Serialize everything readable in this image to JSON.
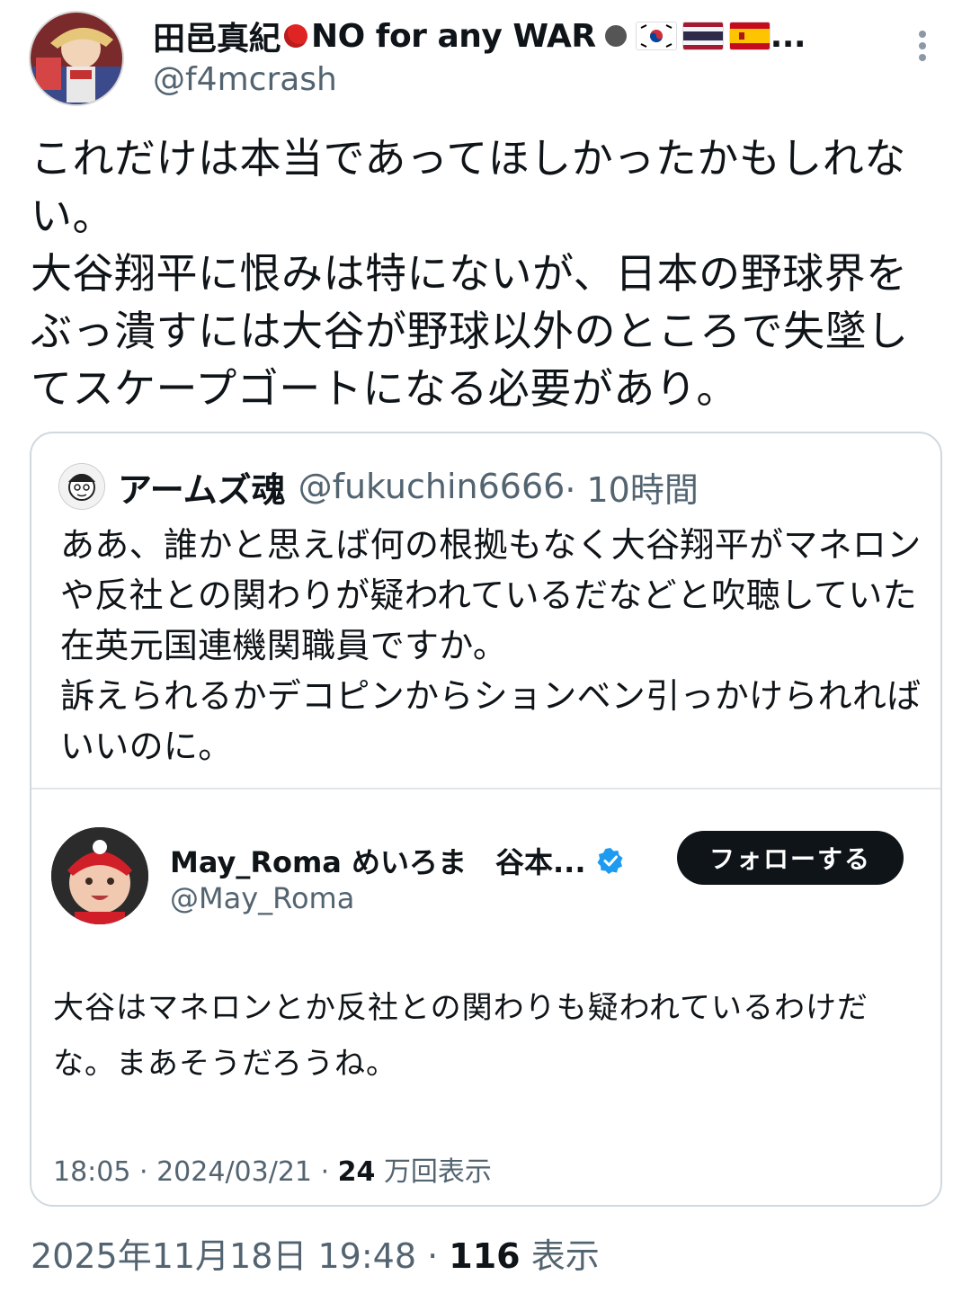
{
  "author": {
    "display_name": "田邑真紀",
    "status_text": "NO for any WAR",
    "ellipsis": "...",
    "handle": "@f4mcrash",
    "flags": [
      "korea-flag",
      "thailand-flag",
      "spain-flag"
    ]
  },
  "tweet": {
    "lines": [
      "これだけは本当であってほしかったかもしれない。",
      "大谷翔平に恨みは特にないが、日本の野球界をぶっ潰すには大谷が野球以外のところで失墜してスケープゴートになる必要があり。"
    ],
    "timestamp": "2025年11月18日 19:48",
    "separator": " · ",
    "views_count": "116",
    "views_label": " 表示"
  },
  "quoted": {
    "display_name": "アームズ魂",
    "handle": "@fukuchin6666",
    "time_ago": " · 10時間",
    "lines": [
      "ああ、誰かと思えば何の根拠もなく大谷翔平がマネロンや反社との関わりが疑われているだなどと吹聴していた在英元国連機関職員ですか。",
      "訴えられるかデコピンからションベン引っかけられればいいのに。"
    ],
    "embedded": {
      "display_name": "May_Roma めいろま　谷本...",
      "handle": "@May_Roma",
      "follow_label": "フォローする",
      "text": "大谷はマネロンとか反社との関わりも疑われているわけだな。まあそうだろうね。",
      "time": "18:05",
      "date": "2024/03/21",
      "views_count": "24",
      "views_label": "万回表示"
    }
  },
  "colors": {
    "text": "#0f1419",
    "secondary": "#536471",
    "verified": "#1d9bf0",
    "border": "#cfd9de"
  }
}
